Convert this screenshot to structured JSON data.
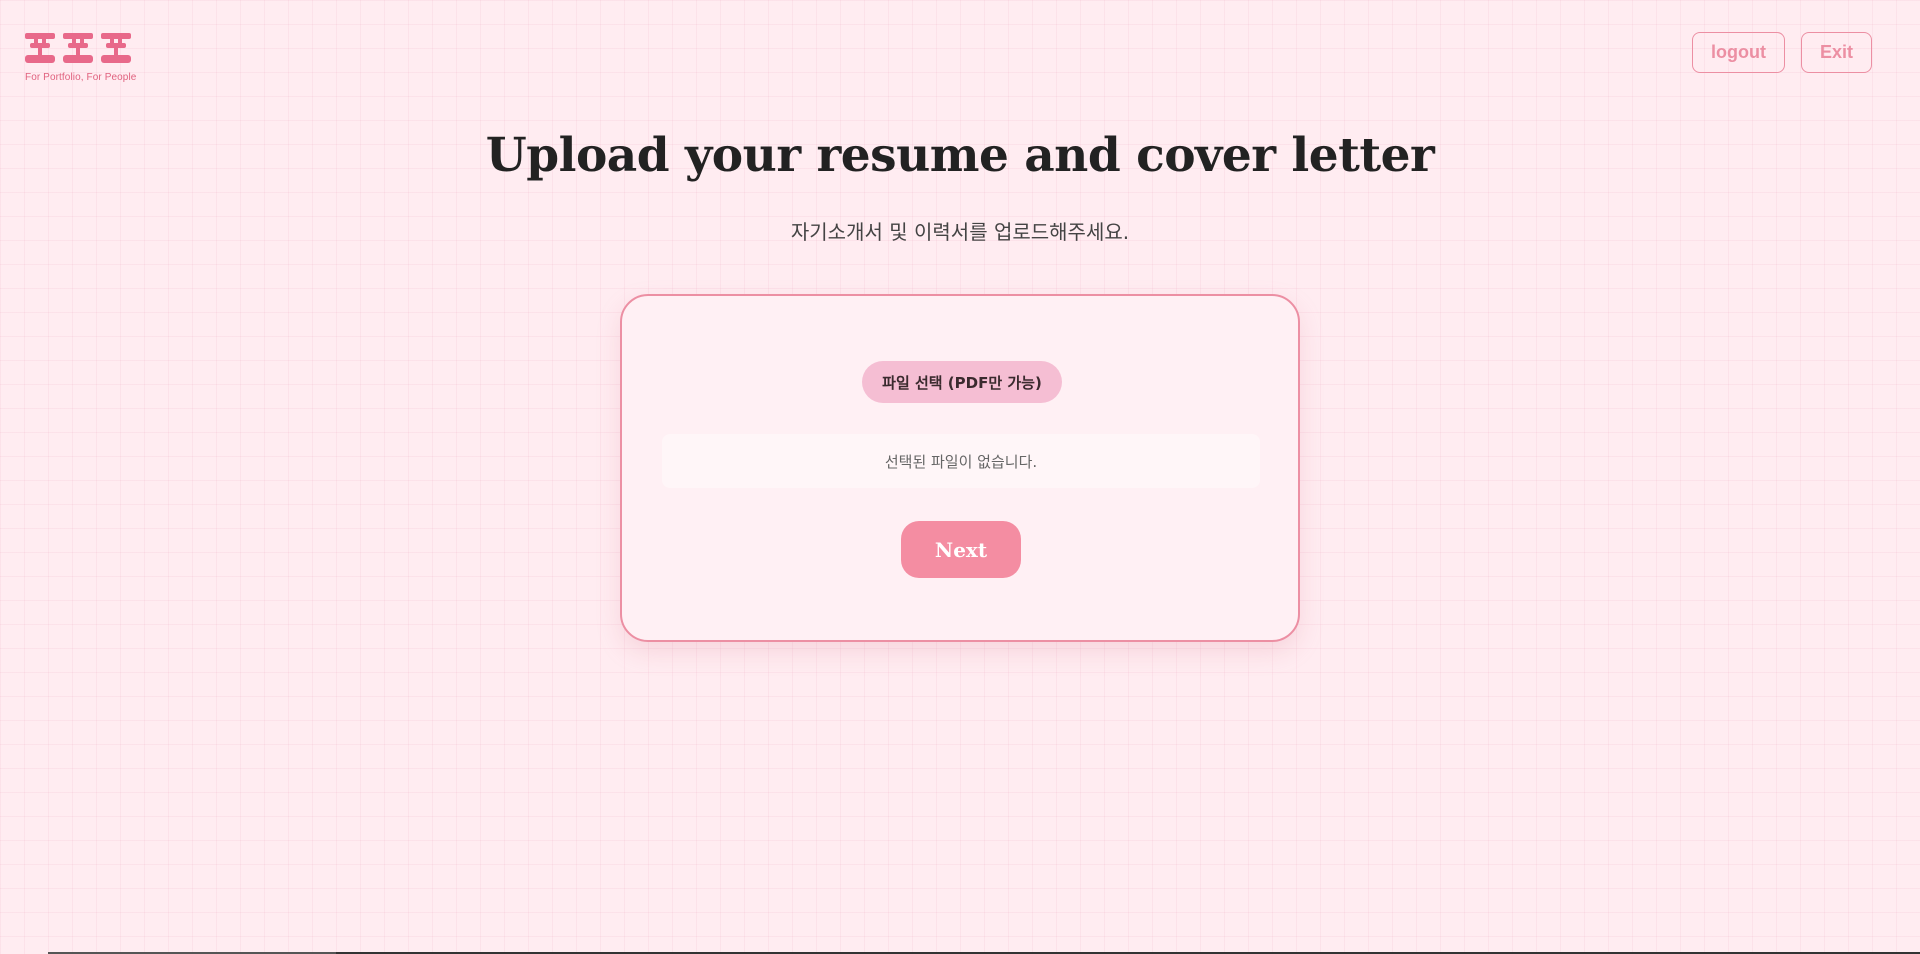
{
  "logo": {
    "text": "포포포",
    "tagline": "For Portfolio, For People"
  },
  "header": {
    "logout_label": "logout",
    "exit_label": "Exit"
  },
  "main": {
    "title": "Upload your resume and cover letter",
    "subtitle": "자기소개서 및 이력서를 업로드해주세요."
  },
  "upload": {
    "file_select_label": "파일 선택 (PDF만 가능)",
    "file_status": "선택된 파일이 없습니다.",
    "next_label": "Next"
  },
  "colors": {
    "background": "#ffecf1",
    "accent": "#ec8fa3",
    "next_button": "#f48da2",
    "file_button": "#f5bed3",
    "logo": "#e0617e"
  }
}
